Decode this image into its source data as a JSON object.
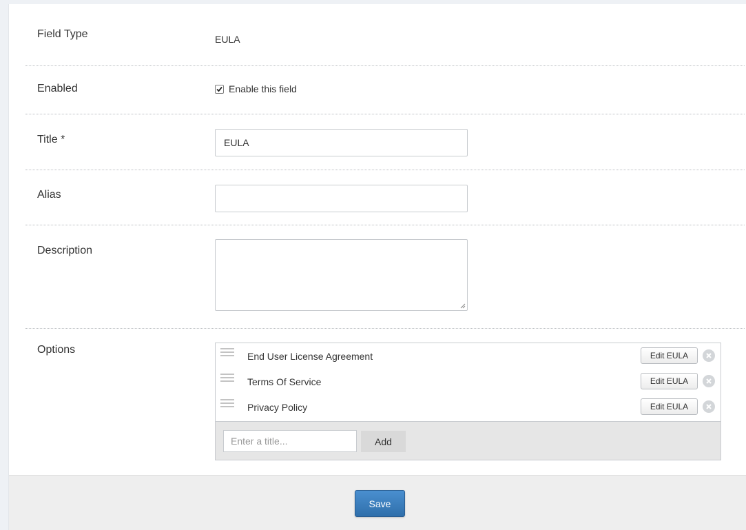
{
  "form": {
    "field_type": {
      "label": "Field Type",
      "value": "EULA"
    },
    "enabled": {
      "label": "Enabled",
      "checkbox_label": "Enable this field",
      "checked": true
    },
    "title": {
      "label": "Title *",
      "value": "EULA"
    },
    "alias": {
      "label": "Alias",
      "value": ""
    },
    "description": {
      "label": "Description",
      "value": ""
    },
    "options": {
      "label": "Options",
      "items": [
        {
          "label": "End User License Agreement",
          "edit_label": "Edit EULA"
        },
        {
          "label": "Terms Of Service",
          "edit_label": "Edit EULA"
        },
        {
          "label": "Privacy Policy",
          "edit_label": "Edit EULA"
        }
      ],
      "add_placeholder": "Enter a title...",
      "add_label": "Add"
    }
  },
  "footer": {
    "save_label": "Save"
  },
  "icons": {
    "drag_handle": "drag-handle-icon",
    "remove": "remove-circle-x-icon",
    "checkmark": "checkmark-icon",
    "resize": "resize-grip-icon"
  },
  "colors": {
    "primary": "#337ab7",
    "background": "#eef1f5",
    "footer": "#eeeeee",
    "options_bar": "#e6e6e6"
  }
}
